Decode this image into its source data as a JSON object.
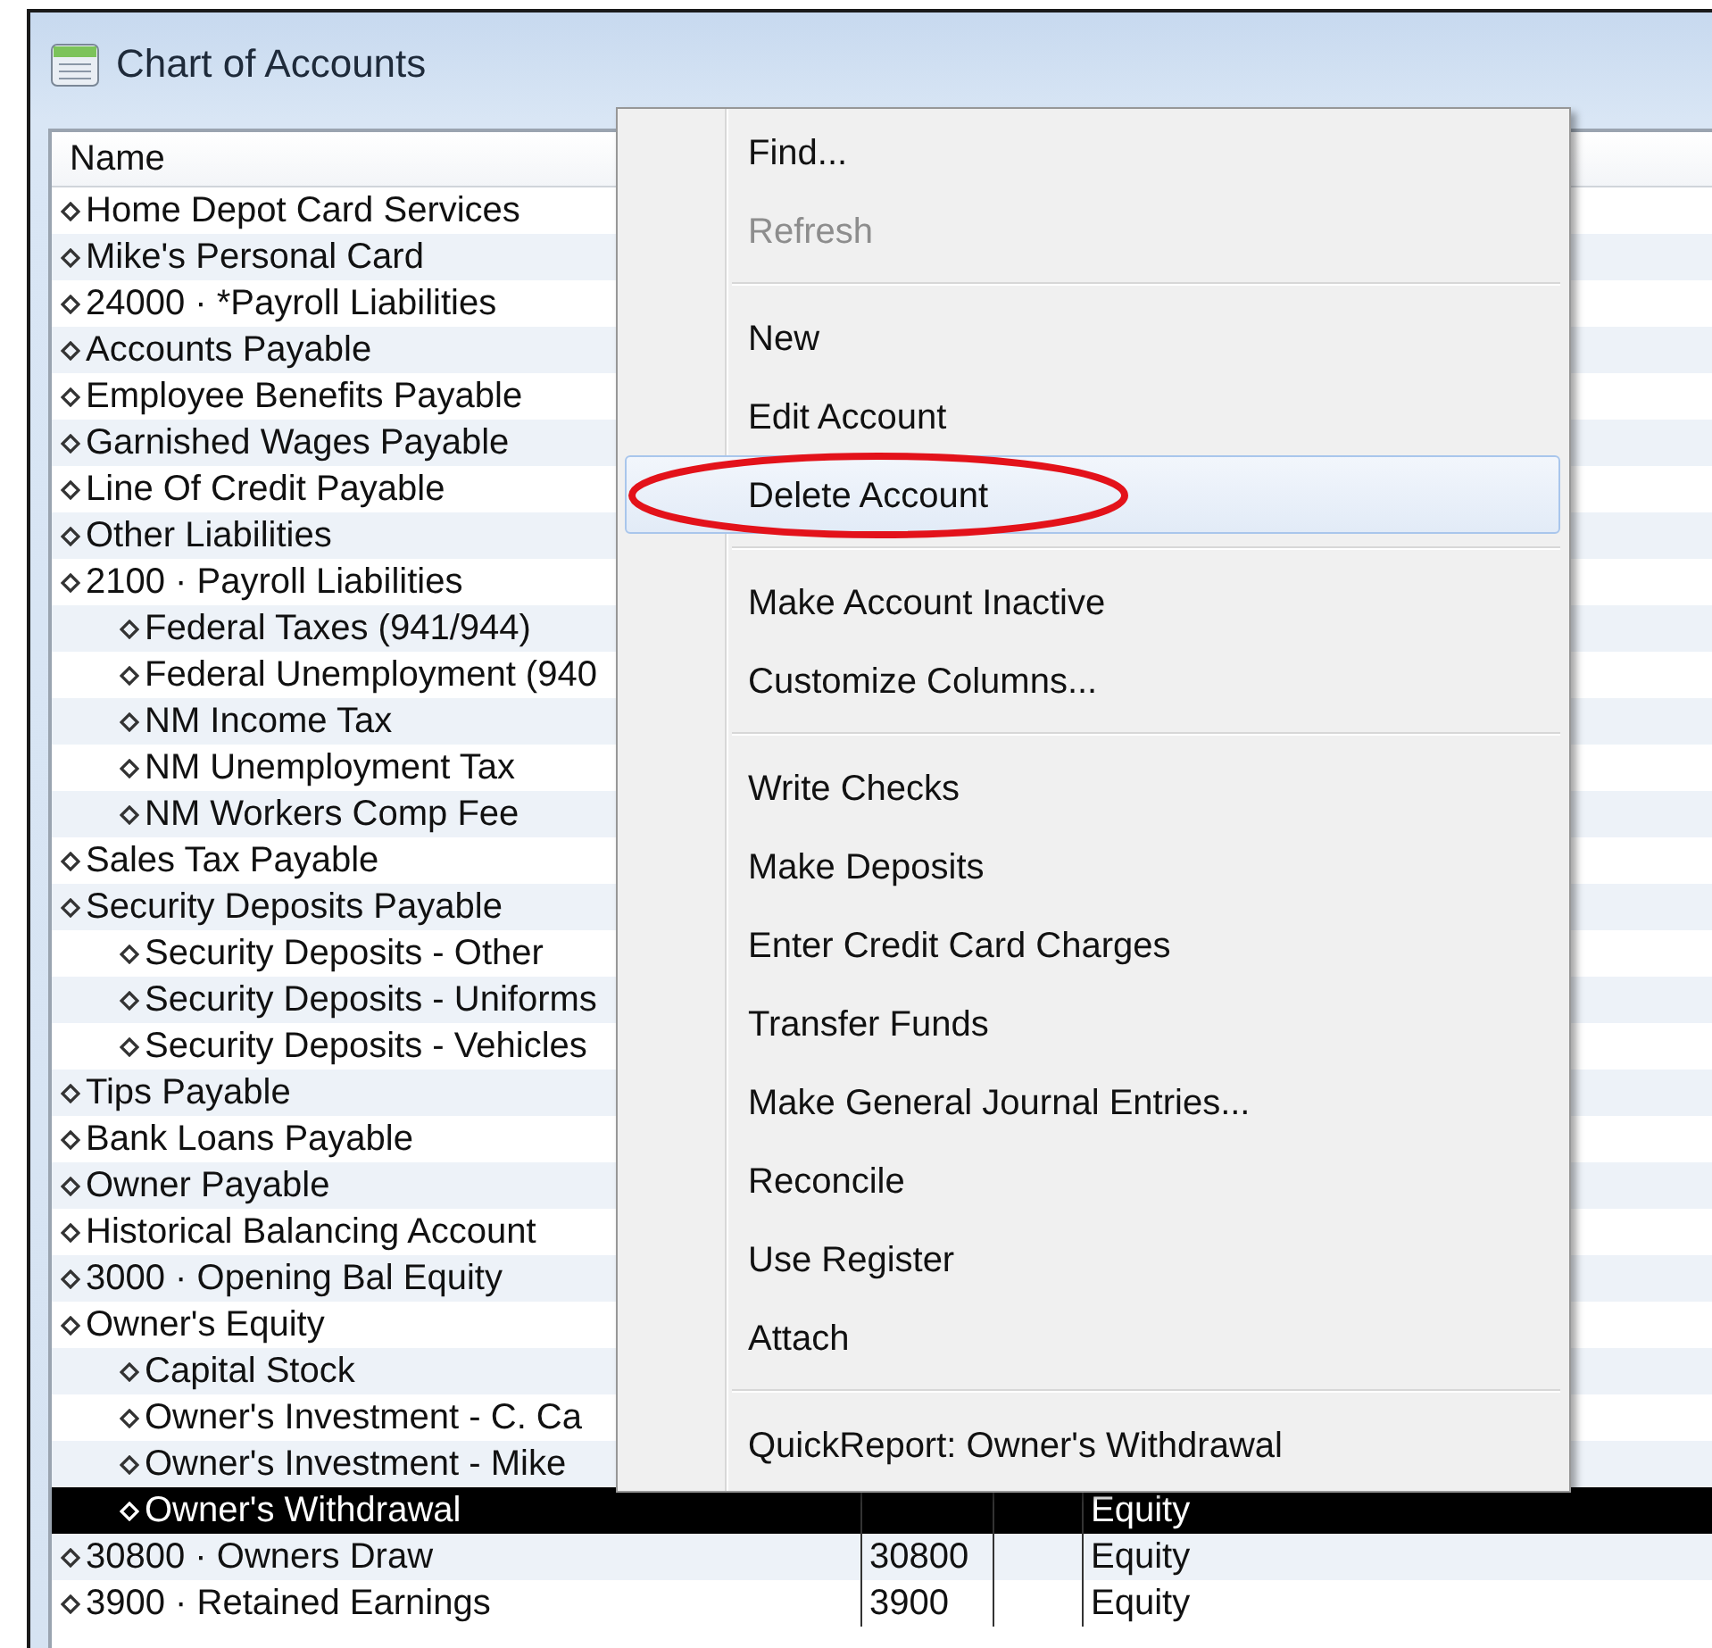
{
  "window": {
    "title": "Chart of Accounts"
  },
  "table": {
    "columns": [
      {
        "label": "Name"
      }
    ],
    "rows": [
      {
        "name": "Home Depot Card Services",
        "selected": false
      },
      {
        "name": "Mike's Personal Card",
        "selected": false
      },
      {
        "name": "24000 · *Payroll Liabilities",
        "selected": false
      },
      {
        "name": "Accounts Payable",
        "selected": false
      },
      {
        "name": "Employee Benefits Payable",
        "selected": false
      },
      {
        "name": "Garnished Wages Payable",
        "selected": false
      },
      {
        "name": "Line Of Credit Payable",
        "selected": false
      },
      {
        "name": "Other Liabilities",
        "selected": false
      },
      {
        "name": "2100 · Payroll Liabilities",
        "selected": false,
        "children": [
          {
            "name": "Federal Taxes (941/944)",
            "selected": false
          },
          {
            "name": "Federal Unemployment (940",
            "selected": false
          },
          {
            "name": "NM Income Tax",
            "selected": false
          },
          {
            "name": "NM Unemployment Tax",
            "selected": false
          },
          {
            "name": "NM Workers Comp Fee",
            "selected": false
          }
        ]
      },
      {
        "name": "Sales Tax Payable",
        "selected": false
      },
      {
        "name": "Security Deposits Payable",
        "selected": false,
        "children": [
          {
            "name": "Security Deposits - Other",
            "selected": false
          },
          {
            "name": "Security Deposits - Uniforms",
            "selected": false
          },
          {
            "name": "Security Deposits - Vehicles",
            "selected": false
          }
        ]
      },
      {
        "name": "Tips Payable",
        "selected": false
      },
      {
        "name": "Bank Loans Payable",
        "selected": false
      },
      {
        "name": "Owner Payable",
        "selected": false
      },
      {
        "name": "Historical Balancing Account",
        "selected": false
      },
      {
        "name": "3000 · Opening Bal Equity",
        "selected": false
      },
      {
        "name": "Owner's Equity",
        "selected": false,
        "children": [
          {
            "name": "Capital Stock",
            "selected": false
          },
          {
            "name": "Owner's Investment - C. Ca",
            "selected": false
          },
          {
            "name": "Owner's Investment - Mike",
            "selected": false
          },
          {
            "name": "Owner's Withdrawal",
            "selected": true,
            "type": "Equity"
          }
        ]
      },
      {
        "name": "30800 · Owners Draw",
        "selected": false,
        "number": "30800",
        "type": "Equity"
      },
      {
        "name": "3900 · Retained Earnings",
        "selected": false,
        "number": "3900",
        "type": "Equity"
      }
    ]
  },
  "menu": {
    "items": [
      {
        "kind": "item",
        "label": "Find...",
        "disabled": false,
        "selected": false,
        "circled": false
      },
      {
        "kind": "item",
        "label": "Refresh",
        "disabled": true,
        "selected": false,
        "circled": false
      },
      {
        "kind": "separator"
      },
      {
        "kind": "item",
        "label": "New",
        "disabled": false,
        "selected": false,
        "circled": false
      },
      {
        "kind": "item",
        "label": "Edit Account",
        "disabled": false,
        "selected": false,
        "circled": false
      },
      {
        "kind": "item",
        "label": "Delete Account",
        "disabled": false,
        "selected": true,
        "circled": true
      },
      {
        "kind": "separator"
      },
      {
        "kind": "item",
        "label": "Make Account Inactive",
        "disabled": false,
        "selected": false,
        "circled": false
      },
      {
        "kind": "item",
        "label": "Customize Columns...",
        "disabled": false,
        "selected": false,
        "circled": false
      },
      {
        "kind": "separator"
      },
      {
        "kind": "item",
        "label": "Write Checks",
        "disabled": false,
        "selected": false,
        "circled": false
      },
      {
        "kind": "item",
        "label": "Make Deposits",
        "disabled": false,
        "selected": false,
        "circled": false
      },
      {
        "kind": "item",
        "label": "Enter Credit Card Charges",
        "disabled": false,
        "selected": false,
        "circled": false
      },
      {
        "kind": "item",
        "label": "Transfer Funds",
        "disabled": false,
        "selected": false,
        "circled": false
      },
      {
        "kind": "item",
        "label": "Make General Journal Entries...",
        "disabled": false,
        "selected": false,
        "circled": false
      },
      {
        "kind": "item",
        "label": "Reconcile",
        "disabled": false,
        "selected": false,
        "circled": false
      },
      {
        "kind": "item",
        "label": "Use Register",
        "disabled": false,
        "selected": false,
        "circled": false
      },
      {
        "kind": "item",
        "label": "Attach",
        "disabled": false,
        "selected": false,
        "circled": false
      },
      {
        "kind": "separator"
      },
      {
        "kind": "item",
        "label": "QuickReport: Owner's Withdrawal",
        "disabled": false,
        "selected": false,
        "circled": false
      }
    ]
  }
}
